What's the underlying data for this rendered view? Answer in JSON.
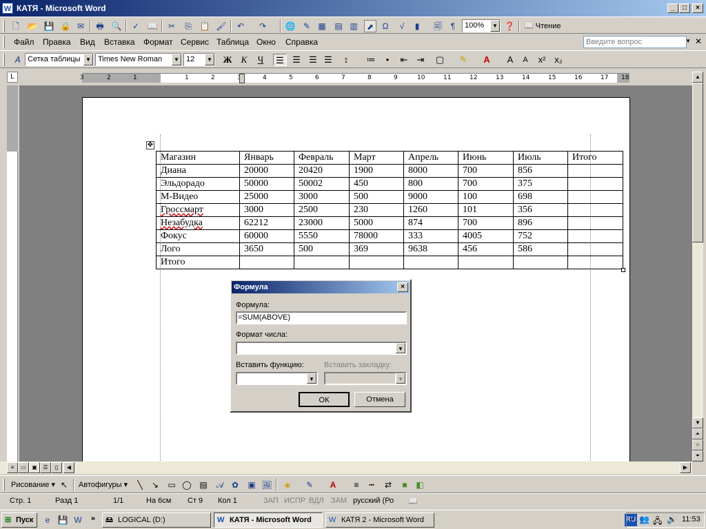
{
  "window": {
    "title": "КАТЯ - Microsoft Word"
  },
  "menu": [
    "Файл",
    "Правка",
    "Вид",
    "Вставка",
    "Формат",
    "Сервис",
    "Таблица",
    "Окно",
    "Справка"
  ],
  "help_box": {
    "placeholder": "Введите вопрос"
  },
  "standard_toolbar": {
    "zoom": "100%",
    "reading_label": "Чтение"
  },
  "format_toolbar": {
    "style": "Сетка таблицы",
    "font": "Times New Roman",
    "size": "12"
  },
  "ruler": {
    "marks": [
      "3",
      "2",
      "1",
      "1",
      "2",
      "3",
      "4",
      "5",
      "6",
      "7",
      "8",
      "9",
      "10",
      "11",
      "12",
      "13",
      "14",
      "15",
      "16",
      "17",
      "18"
    ]
  },
  "table": {
    "header": [
      "Магазин",
      "Январь",
      "Февраль",
      "Март",
      "Апрель",
      "Июнь",
      "Июль",
      "Итого"
    ],
    "rows": [
      [
        "Диана",
        "20000",
        "20420",
        "1900",
        "8000",
        "700",
        "856",
        ""
      ],
      [
        "Эльдорадо",
        "50000",
        "50002",
        "450",
        "800",
        "700",
        "375",
        ""
      ],
      [
        "М-Видео",
        "25000",
        "3000",
        "500",
        "9000",
        "100",
        "698",
        ""
      ],
      [
        "Гроссмарт",
        "3000",
        "2500",
        "230",
        "1260",
        "101",
        "356",
        ""
      ],
      [
        "Незабудка",
        "62212",
        "23000",
        "5000",
        "874",
        "700",
        "896",
        ""
      ],
      [
        "Фокус",
        "60000",
        "5550",
        "78000",
        "333",
        "4005",
        "752",
        ""
      ],
      [
        "Лого",
        "3650",
        "500",
        "369",
        "9638",
        "456",
        "586",
        ""
      ],
      [
        "Итого",
        "",
        "",
        "",
        "",
        "",
        "",
        ""
      ]
    ]
  },
  "dialog": {
    "title": "Формула",
    "formula_label": "Формула:",
    "formula_value": "=SUM(ABOVE)",
    "number_format_label": "Формат числа:",
    "insert_function_label": "Вставить функцию:",
    "insert_bookmark_label": "Вставить закладку:",
    "ok_label": "ОК",
    "cancel_label": "Отмена"
  },
  "drawing_toolbar": {
    "draw_label": "Рисование",
    "autoshapes_label": "Автофигуры"
  },
  "status": {
    "page": "Стр. 1",
    "section": "Разд 1",
    "pages": "1/1",
    "at": "На 6см",
    "line": "Ст 9",
    "col": "Кол 1",
    "rec": "ЗАП",
    "trk": "ИСПР",
    "ext": "ВДЛ",
    "ovr": "ЗАМ",
    "language": "русский (Ро"
  },
  "taskbar": {
    "start_label": "Пуск",
    "items": [
      "LOGICAL (D:)",
      "КАТЯ - Microsoft Word",
      "КАТЯ 2 - Microsoft Word"
    ],
    "lang": "RU",
    "clock": "11:53"
  },
  "colors": {
    "titlebar": "#0a246a",
    "face": "#d4d0c8",
    "workspace": "#808080"
  }
}
